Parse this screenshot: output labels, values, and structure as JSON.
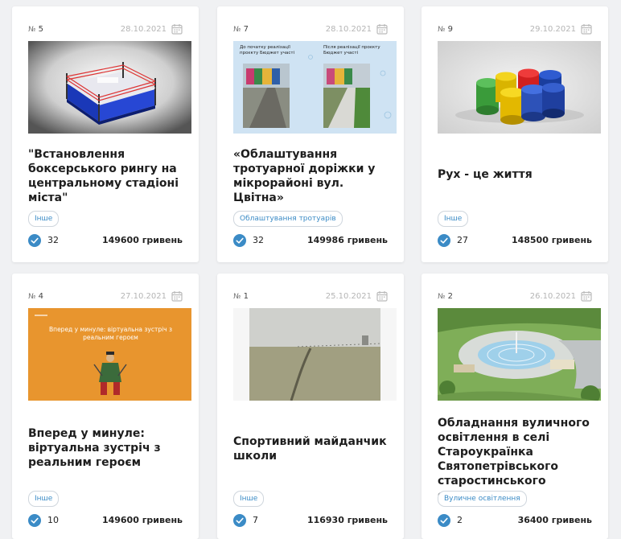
{
  "colors": {
    "accent": "#3b8bc6",
    "check": "#3b8bc6",
    "tag_border": "#cfd6dd",
    "date": "#b5b5b5"
  },
  "icons": {
    "date": "calendar-icon",
    "votes": "check-circle-icon"
  },
  "number_symbol": "№",
  "amount_unit": "гривень",
  "cards": [
    {
      "number": "5",
      "date": "28.10.2021",
      "title": "\"Встановлення боксерського рингу на центральному стадіоні міста\"",
      "tag": "Інше",
      "votes": "32",
      "amount": "149600 гривень"
    },
    {
      "number": "7",
      "date": "28.10.2021",
      "title": "«Облаштування тротуарної доріжки у мікрорайоні вул. Цвітна»",
      "tag": "Облаштування тротуарів",
      "votes": "32",
      "amount": "149986 гривень",
      "photo_caption_left": "До початку реалізації проєкту Бюджет участі",
      "photo_caption_right": "Після реалізації проєкту Бюджет участі"
    },
    {
      "number": "9",
      "date": "29.10.2021",
      "title": "Рух - це життя",
      "tag": "Інше",
      "votes": "27",
      "amount": "148500 гривень"
    },
    {
      "number": "4",
      "date": "27.10.2021",
      "title": "Вперед у минуле: віртуальна зустріч з реальним героєм",
      "tag": "Інше",
      "votes": "10",
      "amount": "149600 гривень",
      "photo_caption": "Вперед у минуле: віртуальна зустріч з реальним героєм"
    },
    {
      "number": "1",
      "date": "25.10.2021",
      "title": "Спортивний майданчик школи",
      "tag": "Інше",
      "votes": "7",
      "amount": "116930 гривень"
    },
    {
      "number": "2",
      "date": "26.10.2021",
      "title": "Обладнання вуличного освітлення в селі Староукраїнка Святопетрівського старостинського округу.",
      "tag": "Вуличне освітлення",
      "votes": "2",
      "amount": "36400 гривень"
    }
  ]
}
